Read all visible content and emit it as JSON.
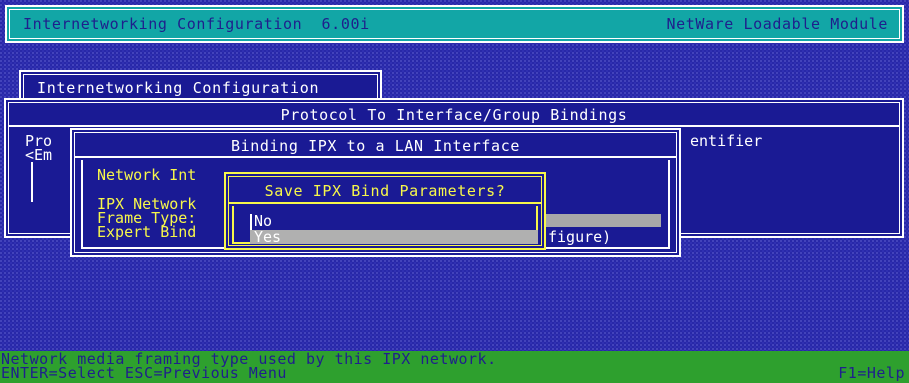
{
  "header": {
    "title": "Internetworking Configuration  6.00i",
    "module_type": "NetWare Loadable Module"
  },
  "main_menu": {
    "title": "Internetworking Configuration"
  },
  "bindings_window": {
    "title": "Protocol To Interface/Group Bindings",
    "column_protocol_fragment": "Pro",
    "column_identifier_fragment": "entifier",
    "empty_row_fragment": "<Em"
  },
  "binding_dialog": {
    "title": "Binding IPX to a LAN Interface",
    "fields": {
      "network_interface": "Network Int",
      "ipx_network": "IPX Network",
      "frame_type": "Frame Type:",
      "expert_bind": "Expert Bind",
      "expert_value_fragment": "figure)"
    }
  },
  "save_dialog": {
    "title": "Save IPX Bind Parameters?",
    "options": [
      "No",
      "Yes"
    ],
    "selected": "Yes"
  },
  "footer": {
    "description": "Network media framing type used by this IPX network.",
    "keys": "ENTER=Select ESC=Previous Menu",
    "help": "F1=Help"
  },
  "colors": {
    "background": "#2828a8",
    "header": "#12a6a6",
    "window": "#1a1a94",
    "highlight_border": "#f7f74a",
    "selection_bar": "#b0b0b0",
    "footer": "#2ea02e"
  }
}
